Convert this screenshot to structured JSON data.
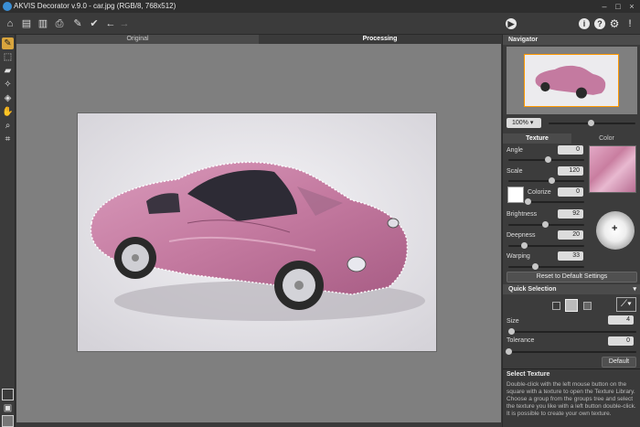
{
  "app": {
    "title": "AKVIS Decorator v.9.0 - car.jpg (RGB/8, 768x512)"
  },
  "view_tabs": {
    "original": "Original",
    "processing": "Processing"
  },
  "navigator": {
    "title": "Navigator",
    "zoom": "100%"
  },
  "panel_tabs": {
    "texture": "Texture",
    "color": "Color"
  },
  "params": {
    "angle": {
      "label": "Angle",
      "value": "0"
    },
    "scale": {
      "label": "Scale",
      "value": "120"
    },
    "colorize": {
      "label": "Colorize",
      "value": "0"
    },
    "brightness": {
      "label": "Brightness",
      "value": "92"
    },
    "deepness": {
      "label": "Deepness",
      "value": "20"
    },
    "warping": {
      "label": "Warping",
      "value": "33"
    }
  },
  "reset_button": "Reset to Default Settings",
  "quick_selection": {
    "title": "Quick Selection",
    "size": {
      "label": "Size",
      "value": "4"
    },
    "tolerance": {
      "label": "Tolerance",
      "value": "0"
    },
    "default_button": "Default"
  },
  "help": {
    "title": "Select Texture",
    "body": "Double-click with the left mouse button on the square with a texture to open the Texture Library. Choose a group from the groups tree and select the texture you like with a left button double-click. It is possible to create your own texture."
  },
  "colors": {
    "accent": "#3a8fd6",
    "texture_pink": "#c97ea0"
  }
}
